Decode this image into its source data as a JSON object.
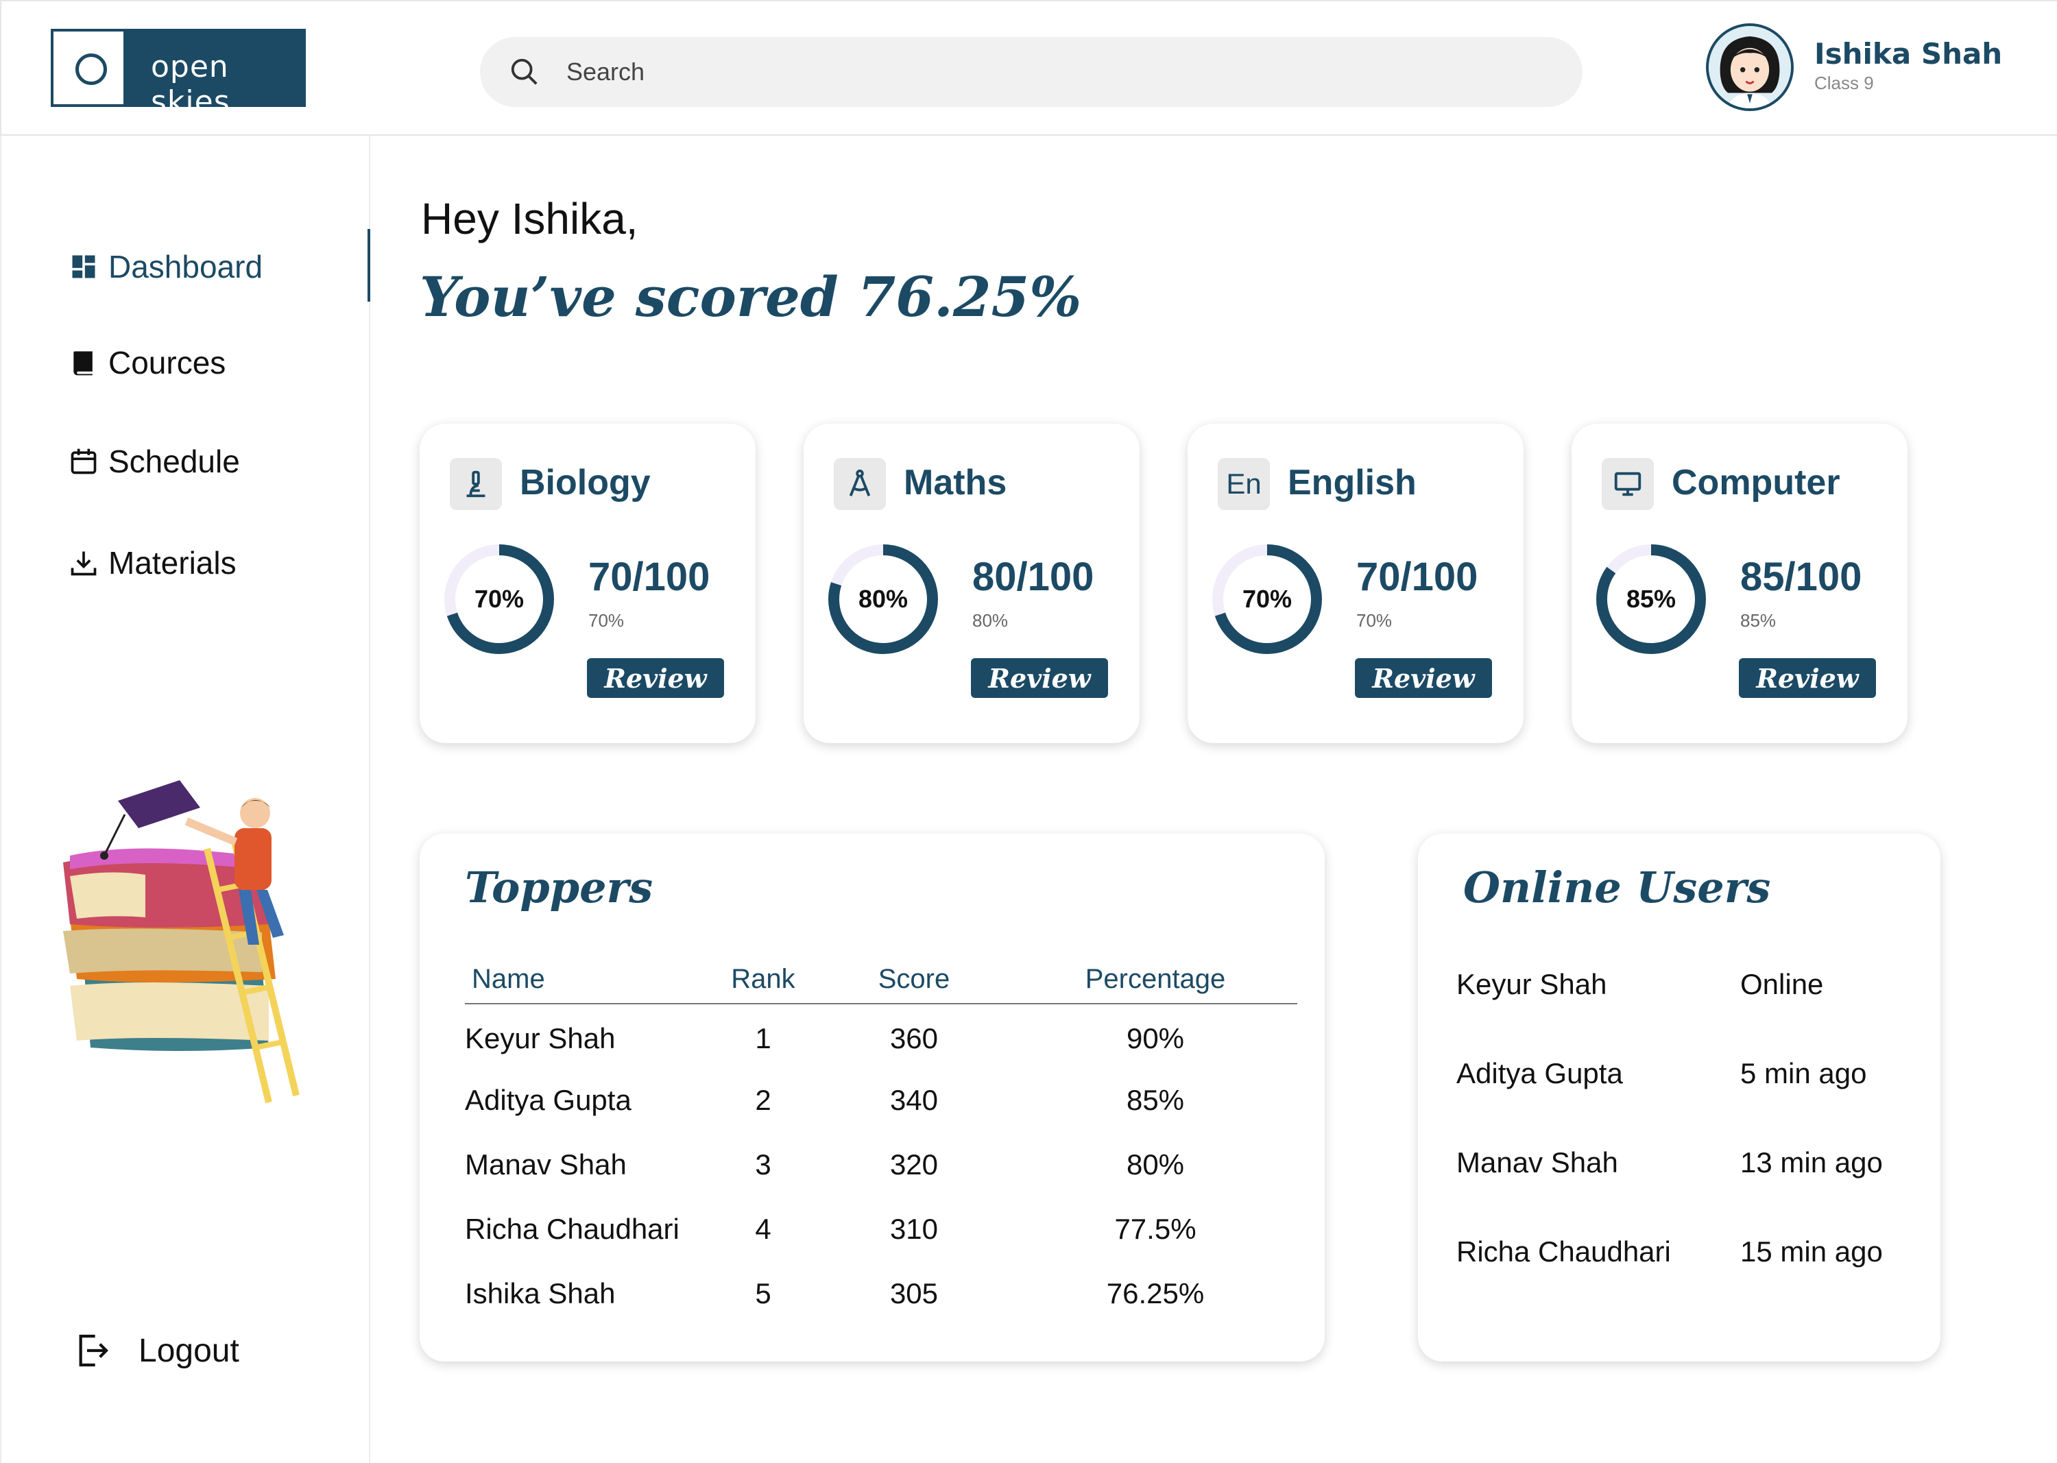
{
  "brand": {
    "name": "open skies"
  },
  "search": {
    "placeholder": "Search"
  },
  "user": {
    "name": "Ishika Shah",
    "class": "Class 9"
  },
  "sidebar": {
    "items": [
      {
        "label": "Dashboard",
        "icon": "dashboard-icon",
        "active": true
      },
      {
        "label": "Cources",
        "icon": "book-icon",
        "active": false
      },
      {
        "label": "Schedule",
        "icon": "calendar-icon",
        "active": false
      },
      {
        "label": "Materials",
        "icon": "download-icon",
        "active": false
      }
    ],
    "logout": "Logout"
  },
  "main": {
    "greeting": "Hey Ishika,",
    "score_line": "You’ve scored 76.25%"
  },
  "subjects": [
    {
      "name": "Biology",
      "icon": "microscope-icon",
      "percent": 70,
      "percent_label": "70%",
      "score": "70/100",
      "sub_label": "70%",
      "button": "Review"
    },
    {
      "name": "Maths",
      "icon": "compass-icon",
      "percent": 80,
      "percent_label": "80%",
      "score": "80/100",
      "sub_label": "80%",
      "button": "Review"
    },
    {
      "name": "English",
      "icon": "language-icon",
      "icon_text": "En",
      "percent": 70,
      "percent_label": "70%",
      "score": "70/100",
      "sub_label": "70%",
      "button": "Review"
    },
    {
      "name": "Computer",
      "icon": "monitor-icon",
      "percent": 85,
      "percent_label": "85%",
      "score": "85/100",
      "sub_label": "85%",
      "button": "Review"
    }
  ],
  "toppers": {
    "title": "Toppers",
    "columns": [
      "Name",
      "Rank",
      "Score",
      "Percentage"
    ],
    "rows": [
      [
        "Keyur Shah",
        "1",
        "360",
        "90%"
      ],
      [
        "Aditya Gupta",
        "2",
        "340",
        "85%"
      ],
      [
        "Manav Shah",
        "3",
        "320",
        "80%"
      ],
      [
        "Richa Chaudhari",
        "4",
        "310",
        "77.5%"
      ],
      [
        "Ishika Shah",
        "5",
        "305",
        "76.25%"
      ]
    ]
  },
  "online_users": {
    "title": "Online Users",
    "users": [
      {
        "name": "Keyur Shah",
        "status": "Online"
      },
      {
        "name": "Aditya Gupta",
        "status": "5  min ago"
      },
      {
        "name": "Manav Shah",
        "status": "13 min ago"
      },
      {
        "name": "Richa Chaudhari",
        "status": "15 min ago"
      }
    ]
  },
  "colors": {
    "primary": "#1c4a64",
    "track": "#f1eefa",
    "card_bg": "#ffffff",
    "icon_bg": "#e9e9e9"
  }
}
